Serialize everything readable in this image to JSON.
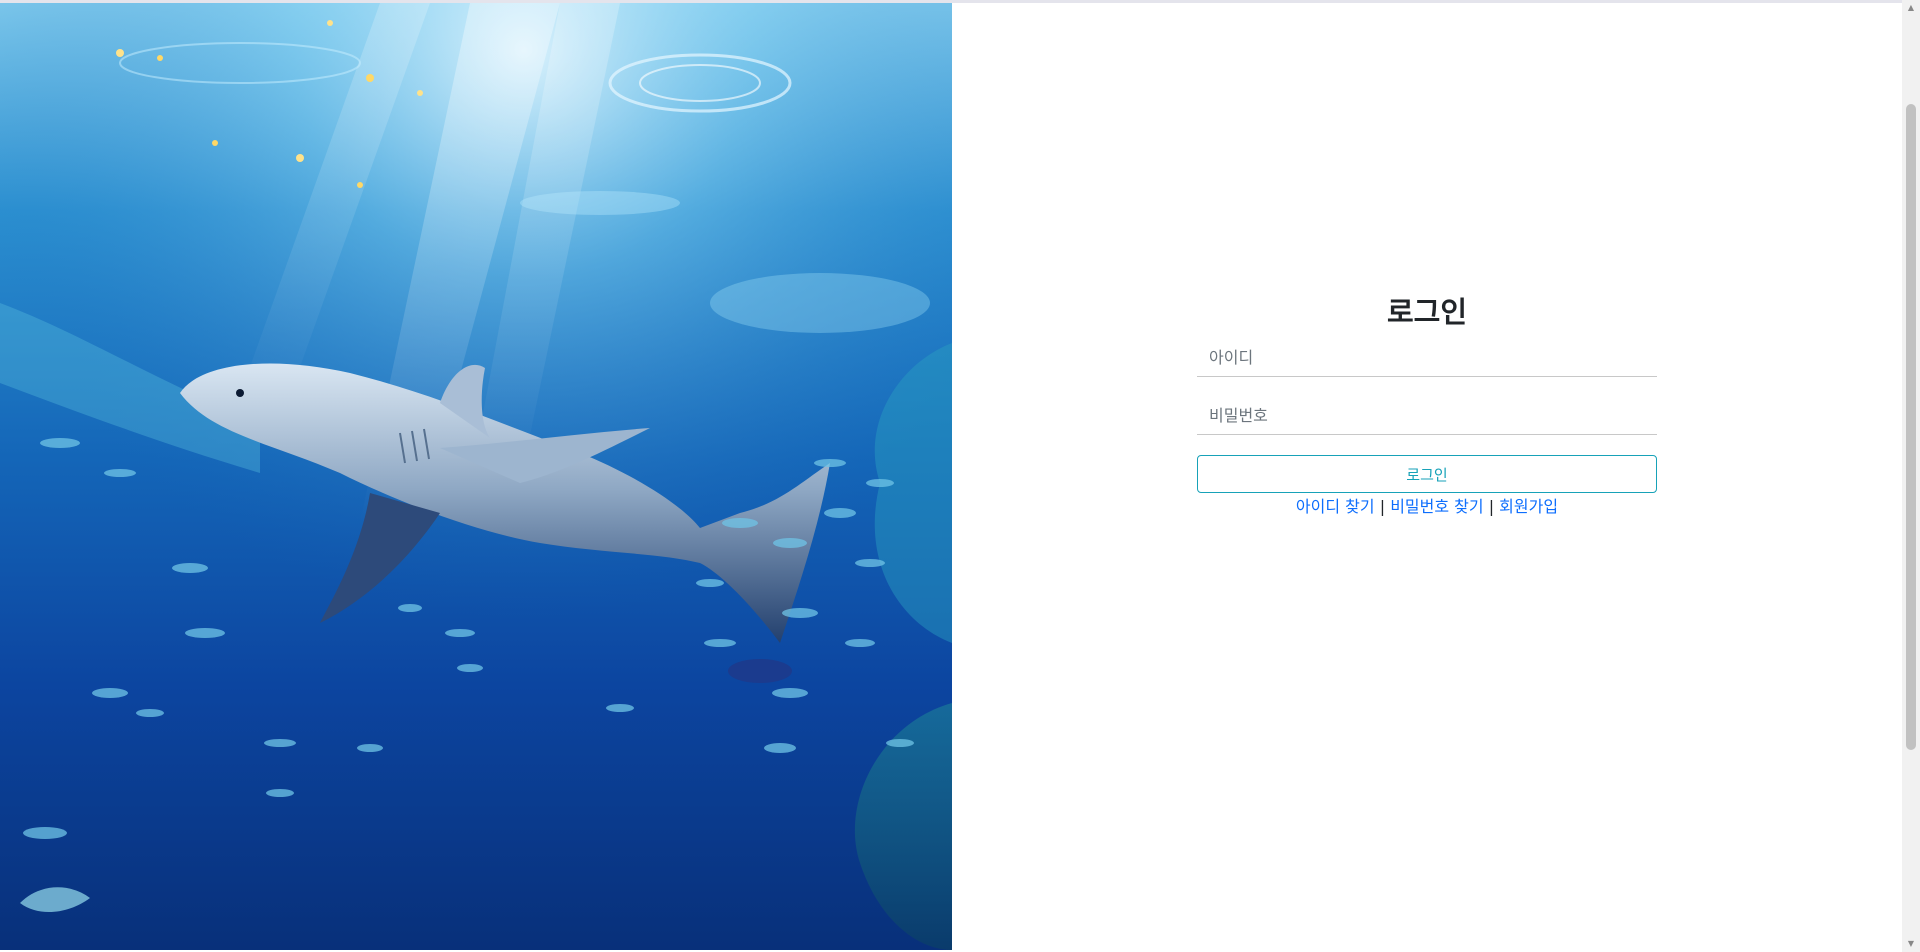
{
  "hero": {
    "image_description": "underwater-shark-image"
  },
  "login": {
    "title": "로그인",
    "id_placeholder": "아이디",
    "password_placeholder": "비밀번호",
    "submit_label": "로그인",
    "find_id_label": "아이디 찾기",
    "find_password_label": "비밀번호 찾기",
    "signup_label": "회원가입",
    "separator": "|"
  },
  "colors": {
    "accent": "#17a2b8",
    "link": "#0d6efd",
    "title": "#212529"
  },
  "icons": {
    "scroll_up": "scroll-up-arrow-icon",
    "scroll_down": "scroll-down-arrow-icon"
  }
}
